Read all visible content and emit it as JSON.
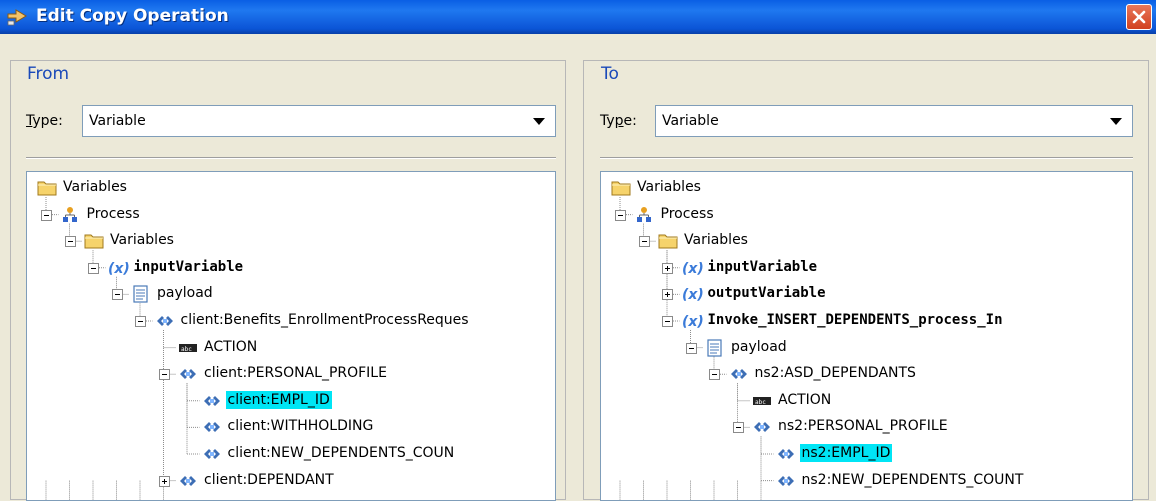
{
  "window": {
    "title": "Edit Copy Operation"
  },
  "from": {
    "legend": "From",
    "type_label_prefix": "",
    "type_label_accel": "T",
    "type_label_rest": "ype:",
    "type_value": "Variable",
    "tree": [
      {
        "label": "Variables",
        "icon": "folder-icon",
        "bold": false,
        "selected": false
      },
      {
        "label": "Process",
        "icon": "process-icon",
        "bold": false,
        "selected": false
      },
      {
        "label": "Variables",
        "icon": "folder-icon",
        "bold": false,
        "selected": false
      },
      {
        "label": "inputVariable",
        "icon": "variable-icon",
        "bold": true,
        "selected": false
      },
      {
        "label": "payload",
        "icon": "document-icon",
        "bold": false,
        "selected": false
      },
      {
        "label": "client:Benefits_EnrollmentProcessReques",
        "icon": "element-icon",
        "bold": false,
        "selected": false
      },
      {
        "label": "ACTION",
        "icon": "attribute-icon",
        "bold": false,
        "selected": false
      },
      {
        "label": "client:PERSONAL_PROFILE",
        "icon": "element-icon",
        "bold": false,
        "selected": false
      },
      {
        "label": "client:EMPL_ID",
        "icon": "element-icon",
        "bold": false,
        "selected": true
      },
      {
        "label": "client:WITHHOLDING",
        "icon": "element-icon",
        "bold": false,
        "selected": false
      },
      {
        "label": "client:NEW_DEPENDENTS_COUN",
        "icon": "element-icon",
        "bold": false,
        "selected": false
      },
      {
        "label": "client:DEPENDANT",
        "icon": "element-icon",
        "bold": false,
        "selected": false
      }
    ]
  },
  "to": {
    "legend": "To",
    "type_label_prefix": "Ty",
    "type_label_accel": "p",
    "type_label_rest": "e:",
    "type_value": "Variable",
    "tree": [
      {
        "label": "Variables",
        "icon": "folder-icon",
        "bold": false,
        "selected": false
      },
      {
        "label": "Process",
        "icon": "process-icon",
        "bold": false,
        "selected": false
      },
      {
        "label": "Variables",
        "icon": "folder-icon",
        "bold": false,
        "selected": false
      },
      {
        "label": "inputVariable",
        "icon": "variable-icon",
        "bold": true,
        "selected": false
      },
      {
        "label": "outputVariable",
        "icon": "variable-icon",
        "bold": true,
        "selected": false
      },
      {
        "label": "Invoke_INSERT_DEPENDENTS_process_In",
        "icon": "variable-icon",
        "bold": true,
        "selected": false
      },
      {
        "label": "payload",
        "icon": "document-icon",
        "bold": false,
        "selected": false
      },
      {
        "label": "ns2:ASD_DEPENDANTS",
        "icon": "element-icon",
        "bold": false,
        "selected": false
      },
      {
        "label": "ACTION",
        "icon": "attribute-icon",
        "bold": false,
        "selected": false
      },
      {
        "label": "ns2:PERSONAL_PROFILE",
        "icon": "element-icon",
        "bold": false,
        "selected": false
      },
      {
        "label": "ns2:EMPL_ID",
        "icon": "element-icon",
        "bold": false,
        "selected": true
      },
      {
        "label": "ns2:NEW_DEPENDENTS_COUNT",
        "icon": "element-icon",
        "bold": false,
        "selected": false
      }
    ]
  },
  "colors": {
    "selection": "#00e5f5",
    "legend": "#1a49b9",
    "titlebar": "#0b54d6"
  }
}
